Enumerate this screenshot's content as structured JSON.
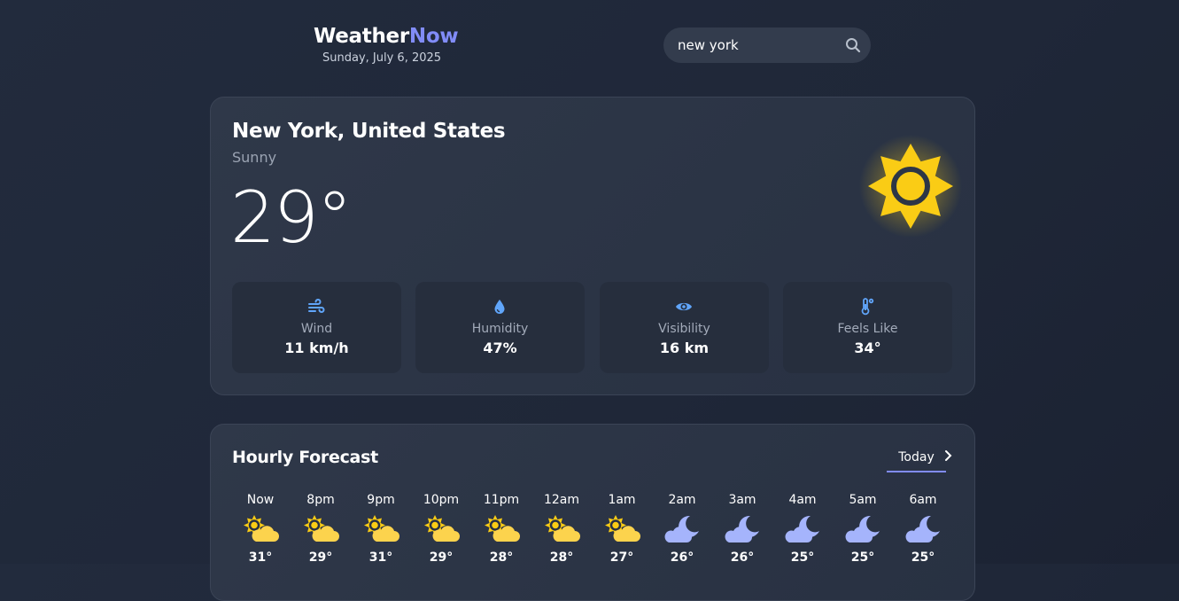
{
  "header": {
    "brand_main": "Weather",
    "brand_accent": "Now",
    "date": "Sunday, July 6, 2025",
    "search_value": "new york",
    "search_icon": "search-icon"
  },
  "current": {
    "location": "New York, United States",
    "condition": "Sunny",
    "temperature": "29°",
    "icon": "sun-icon",
    "stats": [
      {
        "icon": "wind-icon",
        "label": "Wind",
        "value": "11 km/h"
      },
      {
        "icon": "droplet-icon",
        "label": "Humidity",
        "value": "47%"
      },
      {
        "icon": "eye-icon",
        "label": "Visibility",
        "value": "16 km"
      },
      {
        "icon": "thermometer-icon",
        "label": "Feels Like",
        "value": "34°"
      }
    ]
  },
  "hourly": {
    "title": "Hourly Forecast",
    "tab": "Today",
    "hours": [
      {
        "label": "Now",
        "icon": "partly-sunny-icon",
        "temp": "31°"
      },
      {
        "label": "8pm",
        "icon": "partly-sunny-icon",
        "temp": "29°"
      },
      {
        "label": "9pm",
        "icon": "partly-sunny-icon",
        "temp": "31°"
      },
      {
        "label": "10pm",
        "icon": "partly-sunny-icon",
        "temp": "29°"
      },
      {
        "label": "11pm",
        "icon": "partly-sunny-icon",
        "temp": "28°"
      },
      {
        "label": "12am",
        "icon": "partly-sunny-icon",
        "temp": "28°"
      },
      {
        "label": "1am",
        "icon": "partly-sunny-icon",
        "temp": "27°"
      },
      {
        "label": "2am",
        "icon": "cloudy-night-icon",
        "temp": "26°"
      },
      {
        "label": "3am",
        "icon": "cloudy-night-icon",
        "temp": "26°"
      },
      {
        "label": "4am",
        "icon": "cloudy-night-icon",
        "temp": "25°"
      },
      {
        "label": "5am",
        "icon": "cloudy-night-icon",
        "temp": "25°"
      },
      {
        "label": "6am",
        "icon": "cloudy-night-icon",
        "temp": "25°"
      }
    ]
  },
  "colors": {
    "accent": "#818cf8",
    "sun": "#facc15",
    "moon": "#a5b4fc",
    "stat_icon": "#60a5fa"
  }
}
